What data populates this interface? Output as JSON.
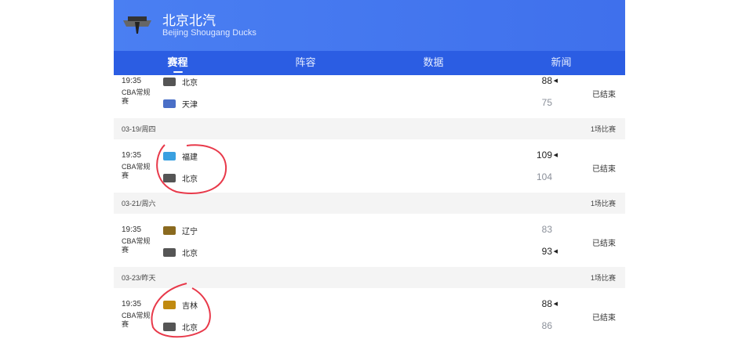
{
  "header": {
    "title": "北京北汽",
    "subtitle": "Beijing Shougang Ducks"
  },
  "tabs": [
    {
      "label": "赛程"
    },
    {
      "label": "阵容"
    },
    {
      "label": "数据"
    },
    {
      "label": "新闻"
    }
  ],
  "days": [
    {
      "date": "",
      "count": "",
      "game": {
        "time": "19:35",
        "league": "CBA常规赛",
        "home": "北京",
        "home_score": "88",
        "away": "天津",
        "away_score": "75",
        "winner": "home",
        "status": "已结束"
      }
    },
    {
      "date": "03-19/周四",
      "count": "1场比赛",
      "game": {
        "time": "19:35",
        "league": "CBA常规赛",
        "home": "福建",
        "home_score": "109",
        "away": "北京",
        "away_score": "104",
        "winner": "home",
        "status": "已结束"
      }
    },
    {
      "date": "03-21/周六",
      "count": "1场比赛",
      "game": {
        "time": "19:35",
        "league": "CBA常规赛",
        "home": "辽宁",
        "home_score": "83",
        "away": "北京",
        "away_score": "93",
        "winner": "away",
        "status": "已结束"
      }
    },
    {
      "date": "03-23/昨天",
      "count": "1场比赛",
      "game": {
        "time": "19:35",
        "league": "CBA常规赛",
        "home": "吉林",
        "home_score": "88",
        "away": "北京",
        "away_score": "86",
        "winner": "home",
        "status": "已结束"
      }
    }
  ],
  "colors": {
    "header": "#4a7ff2",
    "tabbar": "#2b5de3",
    "annotation": "#e8394a"
  }
}
